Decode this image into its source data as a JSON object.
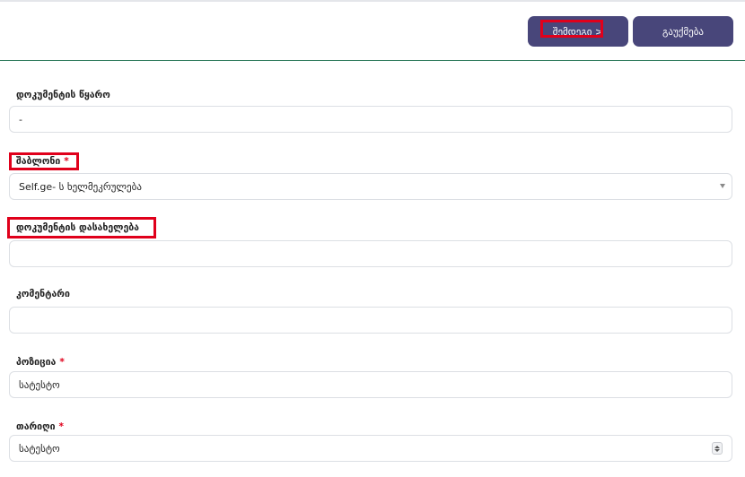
{
  "toolbar": {
    "next_label": "შემდეგი >",
    "cancel_label": "გაუქმება"
  },
  "form": {
    "source": {
      "label": "დოკუმენტის წყარო",
      "value": "-"
    },
    "template": {
      "label": "შაბლონი",
      "required_mark": "*",
      "value": "Self.ge- ს ხელმეკრულება"
    },
    "doc_name": {
      "label": "დოკუმენტის დასახელება",
      "value": ""
    },
    "comment": {
      "label": "კომენტარი",
      "value": ""
    },
    "position": {
      "label": "პოზიცია",
      "required_mark": "*",
      "value": "სატესტო"
    },
    "date": {
      "label": "თარიღი",
      "required_mark": "*",
      "value": "სატესტო"
    }
  },
  "colors": {
    "button_bg": "#48467a",
    "highlight": "#e0001b",
    "divider": "#2e7a5c"
  }
}
